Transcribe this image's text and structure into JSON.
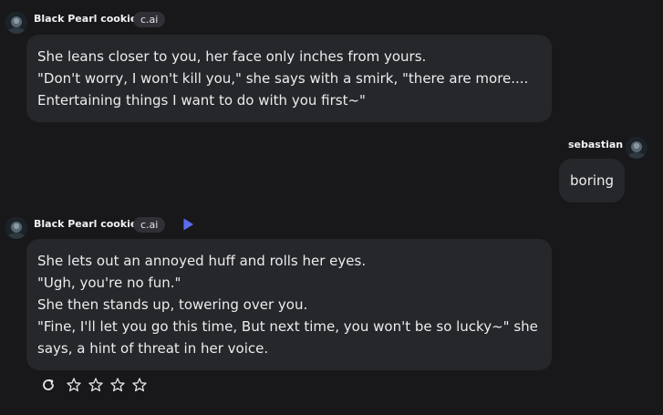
{
  "messages": [
    {
      "author": "Black Pearl cookie",
      "badge": "c.ai",
      "lines": [
        "She leans closer to you, her face only inches from yours.",
        "\"Don't worry, I won't kill you,\" she says with a smirk, \"there are more....",
        "Entertaining things I want to do with you first~\""
      ]
    },
    {
      "author": "sebastian",
      "lines": [
        "boring"
      ]
    },
    {
      "author": "Black Pearl cookie",
      "badge": "c.ai",
      "lines": [
        "She lets out an annoyed huff and rolls her eyes.",
        "\"Ugh, you're no fun.\"",
        "She then stands up, towering over you.",
        "\"Fine, I'll let you go this time, But next time, you won't be so lucky~\" she",
        "says, a hint of threat in her voice."
      ]
    }
  ],
  "icons": {
    "play": "play-icon",
    "regenerate": "refresh-icon",
    "rating": [
      "star-icon",
      "star-icon",
      "star-icon",
      "star-icon"
    ]
  },
  "colors": {
    "background": "#18181b",
    "bubble": "#26272b",
    "badge": "#2f2f35",
    "accent_play": "#5b6cf0",
    "text": "#ececee"
  }
}
